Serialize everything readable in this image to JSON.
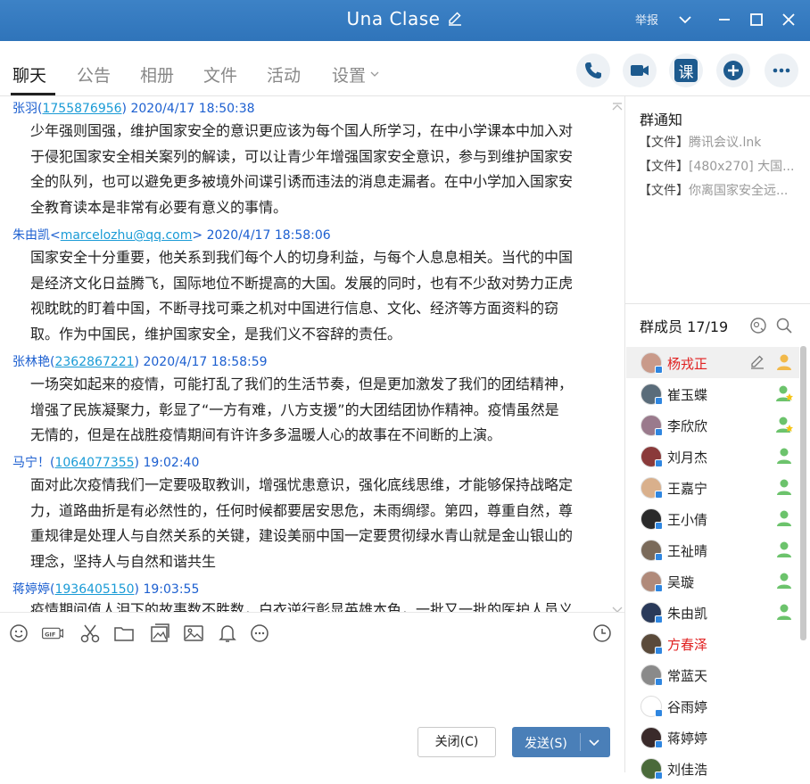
{
  "window": {
    "title": "Una Clase",
    "report_label": "举报"
  },
  "tabs": [
    {
      "label": "聊天"
    },
    {
      "label": "公告"
    },
    {
      "label": "相册"
    },
    {
      "label": "文件"
    },
    {
      "label": "活动"
    },
    {
      "label": "设置"
    }
  ],
  "header_actions": {
    "course_label": "课"
  },
  "messages": [
    {
      "sender": "张羽",
      "uid": "1755876956",
      "uid_open": "(",
      "uid_close": ")",
      "time": "2020/4/17 18:50:38",
      "lines": [
        "少年强则国强，维护国家安全的意识更应该为每个国人所学习，在中小学课本中加入对",
        "于侵犯国家安全相关案列的解读，可以让青少年增强国家安全意识，参与到维护国家安",
        "全的队列，也可以避免更多被境外间谍引诱而违法的消息走漏者。在中小学加入国家安",
        "全教育读本是非常有必要有意义的事情。"
      ]
    },
    {
      "sender": "朱由凯",
      "uid": "marcelozhu@qq.com",
      "uid_open": "<",
      "uid_close": ">",
      "time": "2020/4/17 18:58:06",
      "lines": [
        "国家安全十分重要，他关系到我们每个人的切身利益，与每个人息息相关。当代的中国",
        "是经济文化日益腾飞，国际地位不断提高的大国。发展的同时，也有不少敌对势力正虎",
        "视眈眈的盯着中国，不断寻找可乘之机对中国进行信息、文化、经济等方面资料的窃",
        "取。作为中国民，维护国家安全，是我们义不容辞的责任。"
      ]
    },
    {
      "sender": "张林艳",
      "uid": "2362867221",
      "uid_open": "(",
      "uid_close": ")",
      "time": "2020/4/17 18:58:59",
      "lines": [
        "一场突如起来的疫情，可能打乱了我们的生活节奏，但是更加激发了我们的团结精神，",
        "增强了民族凝聚力，彰显了“一方有难，八方支援”的大团结团协作精神。疫情虽然是",
        "无情的，但是在战胜疫情期间有许许多多温暖人心的故事在不间断的上演。"
      ]
    },
    {
      "sender": "马宁！",
      "uid": "1064077355",
      "uid_open": "(",
      "uid_close": ")",
      "time": "19:02:40",
      "lines": [
        "面对此次疫情我们一定要吸取教训，增强忧患意识，强化底线思维，才能够保持战略定",
        "力，道路曲折是有必然性的，任何时候都要居安思危，未雨绸缪。第四，尊重自然，尊",
        "重规律是处理人与自然关系的关键，建设美丽中国一定要贯彻绿水青山就是金山银山的",
        "理念，坚持人与自然和谐共生"
      ]
    },
    {
      "sender": "蒋婷婷",
      "uid": "1936405150",
      "uid_open": "(",
      "uid_close": ")",
      "time": "19:03:55",
      "lines": [
        "疫情期间值人泪下的故事数不胜数，白衣逆行彰显英雄本色，一批又一批的医护人员义"
      ]
    }
  ],
  "toolbar_icons": [
    "emoji-icon",
    "gif-icon",
    "scissors-icon",
    "folder-icon",
    "image-gallery-icon",
    "picture-icon",
    "bell-icon",
    "more-icon",
    "history-clock-icon"
  ],
  "buttons": {
    "close": "关闭(C)",
    "send": "发送(S)"
  },
  "notice": {
    "title": "群通知",
    "items": [
      {
        "tag": "【文件】",
        "text": "腾讯会议.lnk"
      },
      {
        "tag": "【文件】",
        "text": "[480x270] 大国..."
      },
      {
        "tag": "【文件】",
        "text": "你离国家安全远..."
      }
    ]
  },
  "members": {
    "title": "群成员 17/19",
    "list": [
      {
        "name": "杨戎正",
        "color": "#e02020",
        "badge": "owner",
        "av": "#c99a8a"
      },
      {
        "name": "崔玉蝶",
        "color": "#222222",
        "badge": "admin",
        "av": "#5a6c7a"
      },
      {
        "name": "李欣欣",
        "color": "#222222",
        "badge": "admin",
        "av": "#9a7a8c"
      },
      {
        "name": "刘月杰",
        "color": "#222222",
        "badge": "member",
        "av": "#8a3a3a"
      },
      {
        "name": "王嘉宁",
        "color": "#222222",
        "badge": "member",
        "av": "#d9b08c"
      },
      {
        "name": "王小倩",
        "color": "#222222",
        "badge": "member",
        "av": "#2a2a2a"
      },
      {
        "name": "王祉晴",
        "color": "#222222",
        "badge": "member",
        "av": "#7a6a5a"
      },
      {
        "name": "吴璇",
        "color": "#222222",
        "badge": "member",
        "av": "#b08a7a"
      },
      {
        "name": "朱由凯",
        "color": "#222222",
        "badge": "member",
        "av": "#2a3a5a"
      },
      {
        "name": "方春泽",
        "color": "#e02020",
        "badge": "",
        "av": "#5a4a3a"
      },
      {
        "name": "常蓝天",
        "color": "#222222",
        "badge": "",
        "av": "#8a8a8a"
      },
      {
        "name": "谷雨婷",
        "color": "#222222",
        "badge": "",
        "av": "#ffffff"
      },
      {
        "name": "蒋婷婷",
        "color": "#222222",
        "badge": "",
        "av": "#3a2a2a"
      },
      {
        "name": "刘佳浩",
        "color": "#222222",
        "badge": "",
        "av": "#4a6a3a"
      }
    ]
  }
}
